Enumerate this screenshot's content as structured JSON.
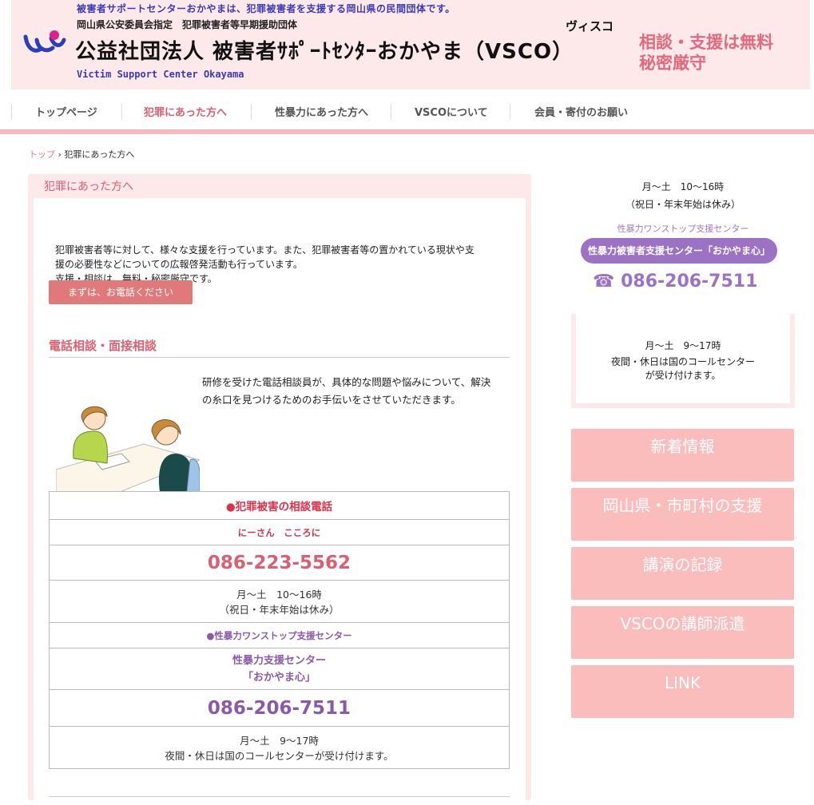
{
  "header": {
    "tagline": "被害者サポートセンターおかやまは、犯罪被害者を支援する岡山県の民間団体です。",
    "designation": "岡山県公安委員会指定　犯罪被害者等早期援助団体",
    "org_name": "公益社団法人 被害者ｻﾎﾟｰﾄｾﾝﾀｰおかやま（VSCO）",
    "ruby": "ヴィスコ",
    "en_name": "Victim Support Center Okayama",
    "free_line1": "相談・支援は無料",
    "free_line2": "秘密厳守"
  },
  "nav": {
    "items": [
      "トップページ",
      "犯罪にあった方へ",
      "性暴力にあった方へ",
      "VSCOについて",
      "会員・寄付のお願い"
    ],
    "active": "犯罪にあった方へ"
  },
  "breadcrumb": {
    "home": "トップ",
    "sep": "›",
    "current": "犯罪にあった方へ"
  },
  "main": {
    "title": "犯罪にあった方へ",
    "intro_line1": "犯罪被害者等に対して、様々な支援を行っています。また、犯罪被害者等の置かれている現状や支",
    "intro_line2": "援の必要性などについての広報啓発活動も行っています。",
    "intro_line3": "支援・相談は、無料・秘密厳守です。",
    "call_button": "まずは、お電話ください",
    "section_title": "電話相談・面接相談",
    "desc_line1": "研修を受けた電話相談員が、具体的な問題や悩みについて、解決",
    "desc_line2": "の糸口を見つけるためのお手伝いをさせていただきます。"
  },
  "table": {
    "crime_heading": "●犯罪被害の相談電話",
    "crime_mnemonic": "にーさん　こころに",
    "crime_phone": "086-223-5562",
    "crime_hours1": "月～土　10～16時",
    "crime_hours2": "（祝日・年末年始は休み）",
    "sv_heading": "●性暴力ワンストップ支援センター",
    "sv_name1": "性暴力支援センター",
    "sv_name2": "「おかやま心」",
    "sv_phone": "086-206-7511",
    "sv_hours1": "月～土　9～17時",
    "sv_hours2": "夜間・休日は国のコールセンターが受け付けます。"
  },
  "sidebar": {
    "hours1": "月～土　10～16時",
    "hours2": "（祝日・年末年始は休み）",
    "label": "性暴力ワンストップ支援センター",
    "pill": "性暴力被害者支援センター「おかやま心」",
    "phone": "086-206-7511",
    "box_hours": "月～土　9～17時",
    "box_note1": "夜間・休日は国のコールセンター",
    "box_note2": "が受け付けます。",
    "buttons": [
      "新着情報",
      "岡山県・市町村の支援",
      "講演の記録",
      "VSCOの講師派遣",
      "LINK"
    ]
  },
  "colors": {
    "pink_bg": "#fde8ea",
    "accent_pink": "#d96070",
    "purple": "#9b72c4",
    "side_button": "#fbbcbc"
  },
  "icons": {
    "logo": "vsco-logo-icon",
    "phone": "phone-icon"
  }
}
